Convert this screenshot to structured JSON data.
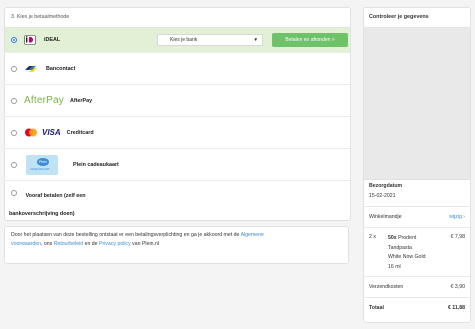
{
  "payment": {
    "header": "3. Kies je betaalmethode",
    "methods": [
      {
        "label": "iDEAL",
        "selected": true,
        "icon": "ideal-logo"
      },
      {
        "label": "Bancontact",
        "icon": "bancontact-logo"
      },
      {
        "label": "AfterPay",
        "logo_text": "AfterPay",
        "icon": "afterpay-logo"
      },
      {
        "label": "Creditcard",
        "logo_text": "VISA",
        "icon": "mastercard-visa-logo"
      },
      {
        "label": "Plein cadeaukaart",
        "card_text": "Plein",
        "card_subtext": "CADEAUKAART",
        "icon": "giftcard-logo"
      }
    ],
    "bank_select": {
      "value": "Kies je bank"
    },
    "pay_button": "Betalen en afronden »",
    "prepay": {
      "line1": "Vooraf betalen (zelf een",
      "line2": "bankoverschrijving doen)"
    }
  },
  "terms": {
    "text1": "Door het plaatsen van deze bestelling ontstaat er een betalingsverplichting en ga je akkoord met de ",
    "link1": "Algemene",
    "link1b": "voorwaarden",
    "text2": ", ons ",
    "link2": "Retourbeleid",
    "text3": " en de ",
    "link3": "Privacy policy",
    "text4": " van Plein.nl"
  },
  "summary": {
    "title": "Controleer je gegevens",
    "delivery_label": "Bezorgdatum",
    "delivery_date": "15-02-2021",
    "cart_label": "Winkelmandje",
    "edit_link": "wijzig ›",
    "item": {
      "qty": "2 x",
      "name_bold": "50x",
      "name_rest1": " Prodent",
      "name_rest2": "Tandpasta",
      "name_rest3": "White Now Gold",
      "name_rest4": "16 ml",
      "price": "€ 7,98"
    },
    "shipping_label": "Verzendkosten",
    "shipping_price": "€ 3,90",
    "total_label": "Totaal",
    "total_price": "€ 11,88"
  },
  "colors": {
    "accent_green": "#6ec26a",
    "selected_row": "#e2f0d6",
    "link_blue": "#3d8bd4"
  }
}
